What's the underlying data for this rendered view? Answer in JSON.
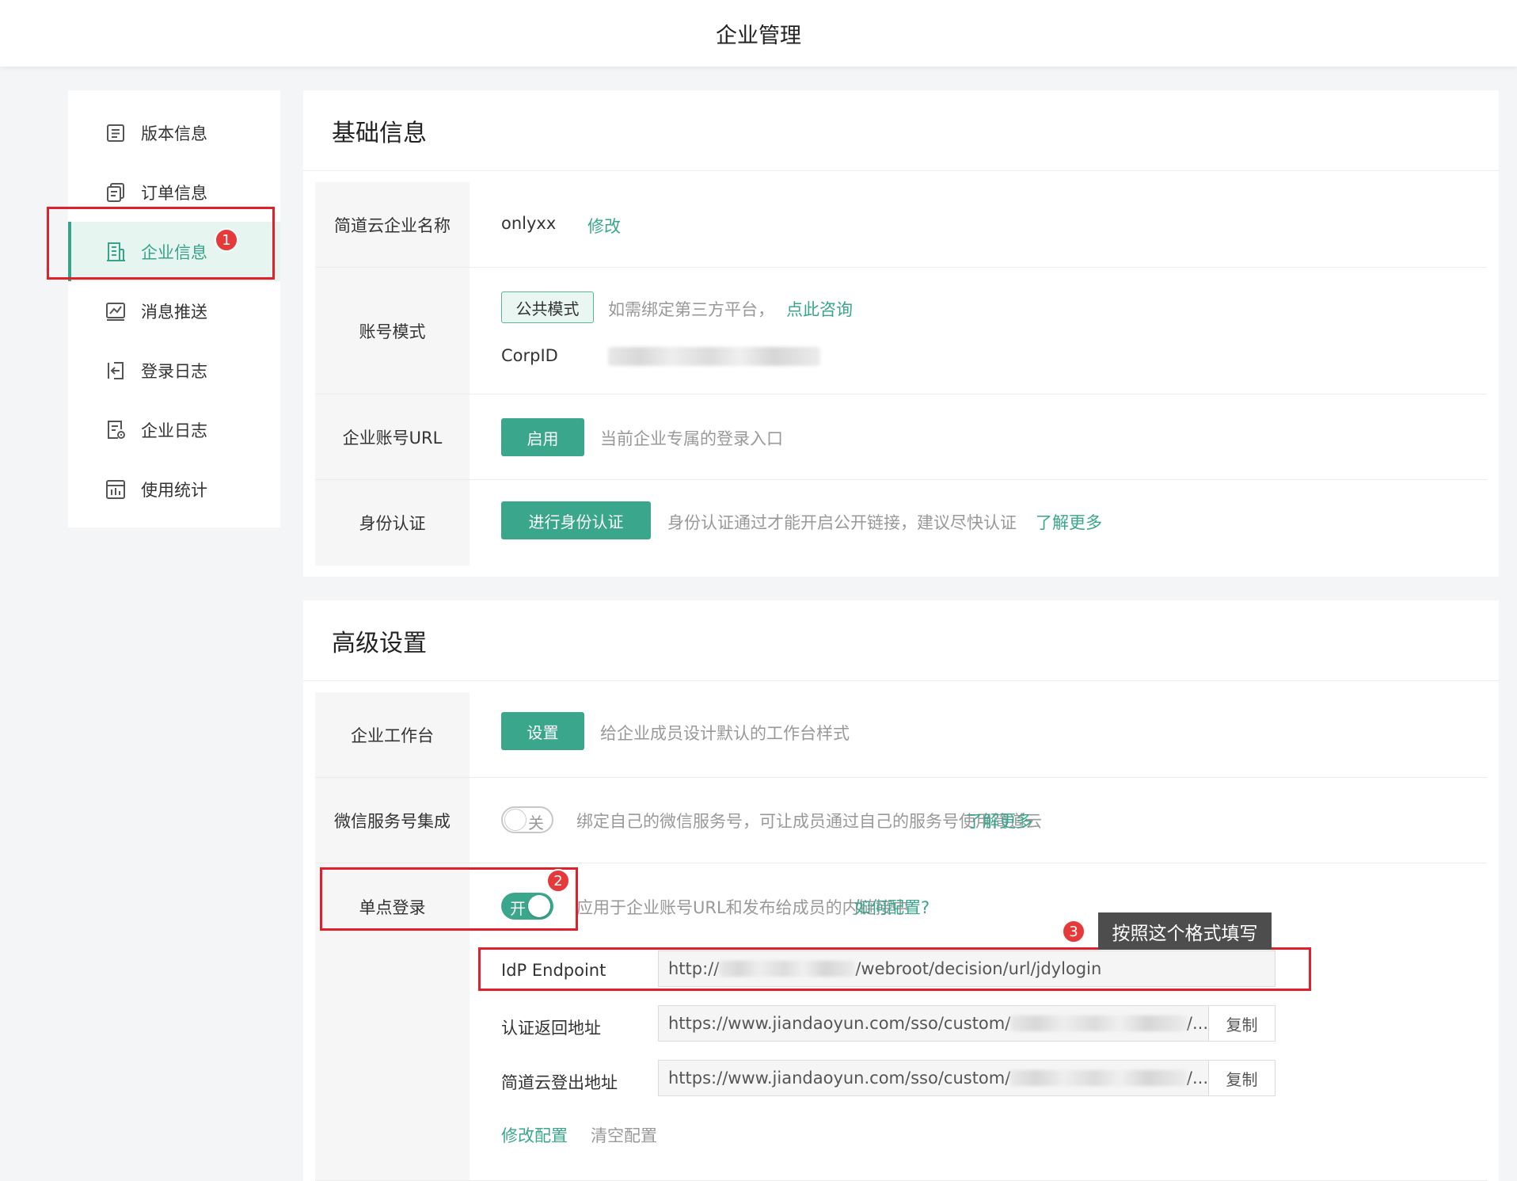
{
  "header": {
    "title": "企业管理"
  },
  "sidebar": {
    "items": [
      {
        "label": "版本信息",
        "icon": "document-list-icon"
      },
      {
        "label": "订单信息",
        "icon": "order-copy-icon"
      },
      {
        "label": "企业信息",
        "icon": "building-icon",
        "active": true
      },
      {
        "label": "消息推送",
        "icon": "chart-line-icon"
      },
      {
        "label": "登录日志",
        "icon": "login-arrow-icon"
      },
      {
        "label": "企业日志",
        "icon": "log-settings-icon"
      },
      {
        "label": "使用统计",
        "icon": "bar-stats-icon"
      }
    ]
  },
  "annotations": {
    "badge1": "1",
    "badge2": "2",
    "badge3": "3",
    "tooltip": "按照这个格式填写"
  },
  "basic": {
    "title": "基础信息",
    "name_row": {
      "label": "简道云企业名称",
      "value": "onlyxx",
      "edit_link": "修改"
    },
    "account_row": {
      "label": "账号模式",
      "mode_tag": "公共模式",
      "hint": "如需绑定第三方平台，",
      "consult_link": "点此咨询",
      "corpid_label": "CorpID"
    },
    "url_row": {
      "label": "企业账号URL",
      "button": "启用",
      "hint": "当前企业专属的登录入口"
    },
    "auth_row": {
      "label": "身份认证",
      "button": "进行身份认证",
      "hint": "身份认证通过才能开启公开链接，建议尽快认证",
      "more_link": "了解更多"
    }
  },
  "advanced": {
    "title": "高级设置",
    "workbench_row": {
      "label": "企业工作台",
      "button": "设置",
      "hint": "给企业成员设计默认的工作台样式"
    },
    "wechat_row": {
      "label": "微信服务号集成",
      "toggle_label": "关",
      "toggle_on": false,
      "hint": "绑定自己的微信服务号，可让成员通过自己的服务号使用简道云",
      "more_link": "了解更多"
    },
    "sso_row": {
      "label": "单点登录",
      "toggle_label": "开",
      "toggle_on": true,
      "hint": "应用于企业账号URL和发布给成员的内链接中",
      "config_link": "如何配置?",
      "idp_label": "IdP Endpoint",
      "idp_prefix": "http://",
      "idp_suffix": "/webroot/decision/url/jdylogin",
      "callback_label": "认证返回地址",
      "callback_prefix": "https://www.jiandaoyun.com/sso/custom/",
      "callback_suffix": "/...",
      "logout_label": "简道云登出地址",
      "logout_prefix": "https://www.jiandaoyun.com/sso/custom/",
      "logout_suffix": "/...",
      "copy_label": "复制",
      "edit_config": "修改配置",
      "clear_config": "清空配置"
    }
  },
  "colors": {
    "accent": "#3aa68c",
    "annotation_red": "#e1202b"
  }
}
